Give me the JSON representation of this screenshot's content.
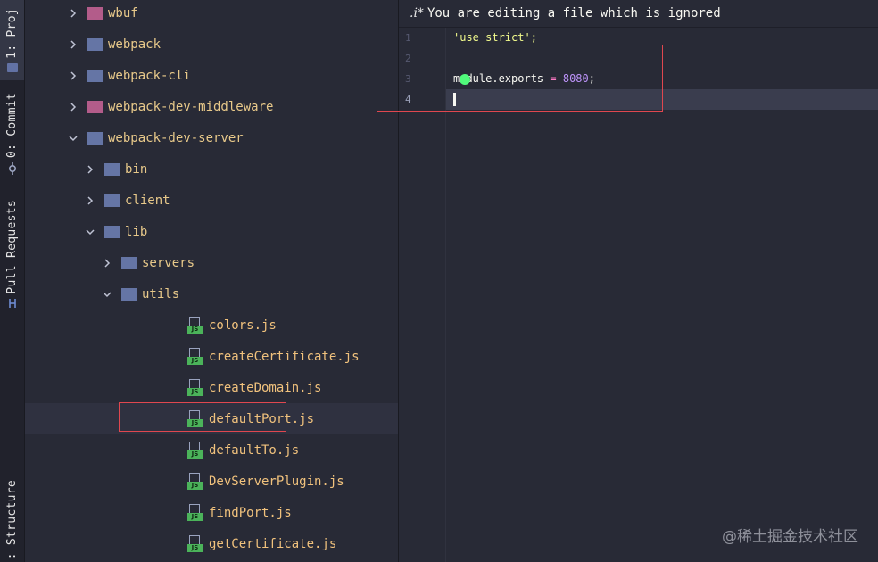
{
  "sidebar": {
    "tabs": [
      {
        "label": "1: Proj",
        "icon": "folder-icon",
        "active": true
      },
      {
        "label": "0: Commit",
        "icon": "commit-icon",
        "active": false
      },
      {
        "label": "Pull Requests",
        "icon": "pull-request-icon",
        "active": false
      },
      {
        "label": ": Structure",
        "icon": "structure-icon",
        "active": false
      }
    ]
  },
  "tree": {
    "items": [
      {
        "name": "wbuf",
        "type": "folder",
        "color": "#b35c8a",
        "expanded": false
      },
      {
        "name": "webpack",
        "type": "folder",
        "color": "#6575a5",
        "expanded": false
      },
      {
        "name": "webpack-cli",
        "type": "folder",
        "color": "#6575a5",
        "expanded": false
      },
      {
        "name": "webpack-dev-middleware",
        "type": "folder",
        "color": "#b35c8a",
        "expanded": false
      },
      {
        "name": "webpack-dev-server",
        "type": "folder",
        "color": "#6575a5",
        "expanded": true
      },
      {
        "name": "bin",
        "type": "folder",
        "color": "#6575a5",
        "expanded": false
      },
      {
        "name": "client",
        "type": "folder",
        "color": "#6575a5",
        "expanded": false
      },
      {
        "name": "lib",
        "type": "folder",
        "color": "#6575a5",
        "expanded": true
      },
      {
        "name": "servers",
        "type": "folder",
        "color": "#6575a5",
        "expanded": false
      },
      {
        "name": "utils",
        "type": "folder",
        "color": "#6575a5",
        "expanded": true
      },
      {
        "name": "colors.js",
        "type": "js"
      },
      {
        "name": "createCertificate.js",
        "type": "js"
      },
      {
        "name": "createDomain.js",
        "type": "js"
      },
      {
        "name": "defaultPort.js",
        "type": "js",
        "selected": true
      },
      {
        "name": "defaultTo.js",
        "type": "js"
      },
      {
        "name": "DevServerPlugin.js",
        "type": "js"
      },
      {
        "name": "findPort.js",
        "type": "js"
      },
      {
        "name": "getCertificate.js",
        "type": "js"
      }
    ],
    "js_badge": "JS"
  },
  "editor": {
    "banner_icon": ".i*",
    "banner_text": "You are editing a file which is ignored",
    "line_numbers": [
      "1",
      "2",
      "3",
      "4"
    ],
    "lines": {
      "l1": "'use strict';",
      "l3_a": "module.exports",
      "l3_op": " = ",
      "l3_num": "8080",
      "l3_end": ";"
    },
    "current_line": 4
  },
  "watermark": "@稀土掘金技术社区"
}
